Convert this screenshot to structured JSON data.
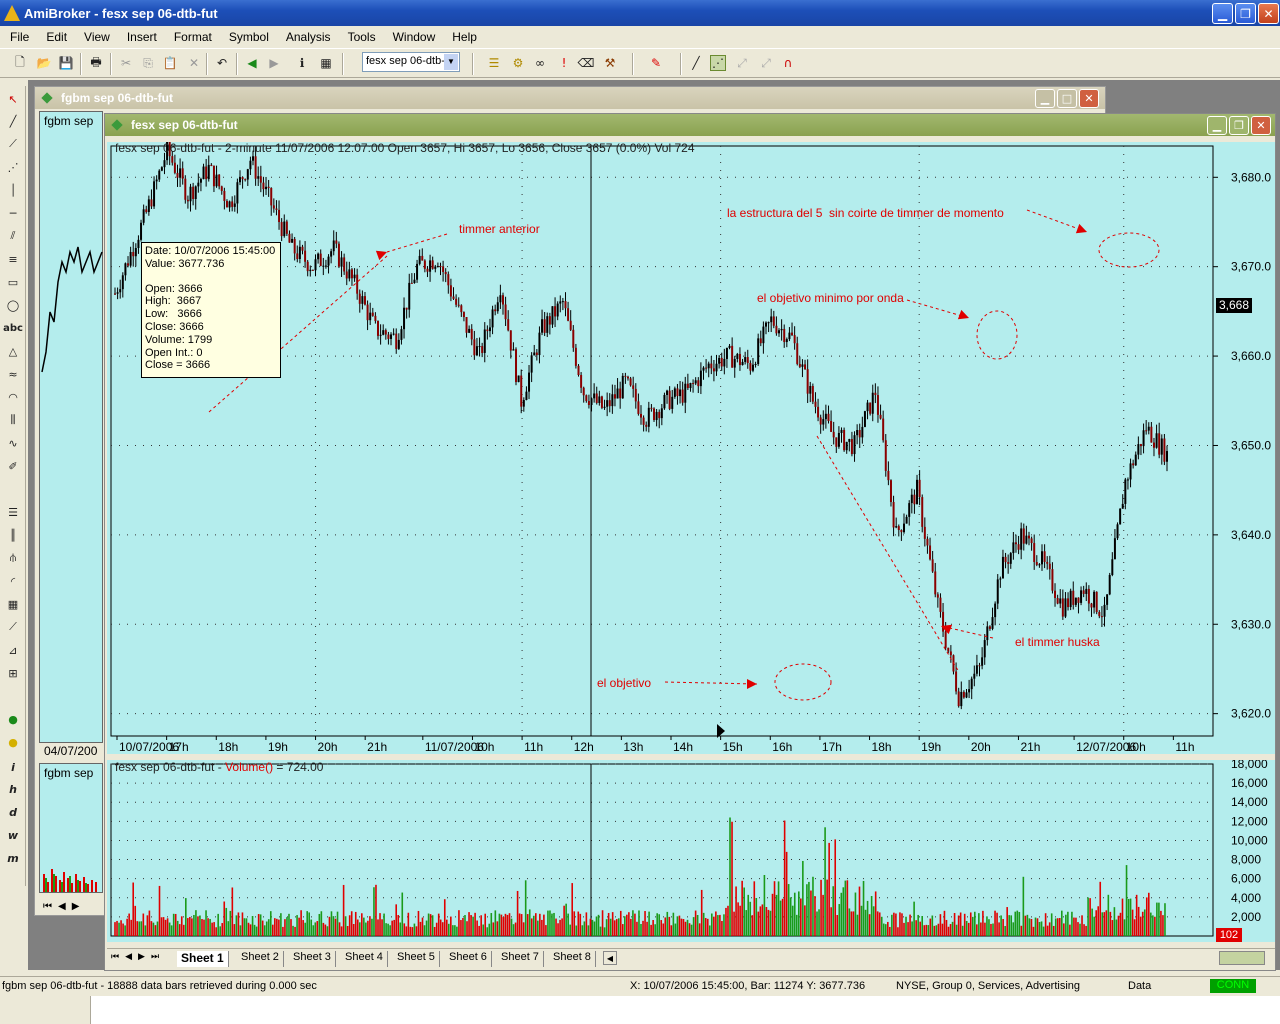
{
  "app": {
    "title": "AmiBroker - fesx sep 06-dtb-fut",
    "min_glyph": "▁",
    "max_glyph": "❐",
    "close_glyph": "✕"
  },
  "menu": [
    "File",
    "Edit",
    "View",
    "Insert",
    "Format",
    "Symbol",
    "Analysis",
    "Tools",
    "Window",
    "Help"
  ],
  "toolbar": {
    "symbol_value": "fesx sep 06-dtb-",
    "icons": [
      "new-icon",
      "open-icon",
      "save-icon",
      "print-icon",
      "cut-icon",
      "copy-icon",
      "paste-icon",
      "delete-icon",
      "undo-icon",
      "back-icon",
      "forward-icon",
      "info-icon",
      "calendar-icon",
      "database-icon",
      "gear-icon",
      "binoculars-icon",
      "alert-icon",
      "eraser-icon",
      "hammer-icon",
      "color-pen-icon",
      "line-icon",
      "dashed-line-icon",
      "magnet-icon"
    ]
  },
  "left_tools": [
    "select",
    "line",
    "ray",
    "extended-line",
    "vertical-line",
    "horizontal-line",
    "parallel-lines",
    "fibonacci",
    "rectangle",
    "ellipse",
    "text",
    "triangle",
    "arc",
    "curve",
    "cycle",
    "zigzag",
    "pen",
    "list",
    "bars",
    "pitchfork",
    "arc-fan",
    "grid",
    "fan",
    "ruler",
    "pattern",
    "green-button",
    "yellow-button",
    "italic-i",
    "italic-h",
    "italic-d",
    "italic-w",
    "italic-m"
  ],
  "left_tools_text": {
    "abc": "abc",
    "i": "i",
    "h": "h",
    "d": "d",
    "w": "w",
    "m": "m"
  },
  "windows": {
    "back_title": "fgbm sep 06-dtb-fut",
    "back_pane_label": "fgbm sep",
    "back_date_label": "04/07/200",
    "back_vol_label": "fgbm sep",
    "front_title": "fesx sep 06-dtb-fut"
  },
  "chart_header": "fesx sep 06-dtb-fut - 2-minute 11/07/2006 12:07:00 Open 3657, Hi 3657, Lo 3656, Close 3657 (0.0%) Vol 724",
  "volume_header": {
    "prefix": "fesx sep 06-dtb-fut - ",
    "func": "Volume()",
    "value": " = 724.00"
  },
  "tooltip": {
    "date": "Date: 10/07/2006 15:45:00",
    "value": "Value: 3677.736",
    "open": "Open: 3666",
    "high": "High:  3667",
    "low": "Low:   3666",
    "close": "Close: 3666",
    "volume": "Volume: 1799",
    "open_int": "Open Int.: 0",
    "close_eq": "Close = 3666"
  },
  "price_badge": "3,668",
  "vol_badge": "102",
  "annotations": {
    "timmer_anterior": "timmer anterior",
    "estructura": "la estructura del 5  sin coirte de timmer de momento",
    "objetivo_minimo": "el objetivo minimo por onda",
    "timmer_huska": "el timmer huska",
    "objetivo": "el objetivo"
  },
  "chart_data": [
    {
      "type": "candlestick",
      "title": "fesx sep 06-dtb-fut - 2-minute",
      "y_ticks": [
        "3,680.0",
        "3,670.0",
        "3,660.0",
        "3,650.0",
        "3,640.0",
        "3,630.0",
        "3,620.0"
      ],
      "y_tick_values": [
        3680,
        3670,
        3660,
        3650,
        3640,
        3630,
        3620
      ],
      "ylim": [
        3617.5,
        3683.5
      ],
      "x_ticks": [
        "10/07/2006",
        "17h",
        "18h",
        "19h",
        "20h",
        "21h",
        "11/07/2006",
        "10h",
        "11h",
        "12h",
        "13h",
        "14h",
        "15h",
        "16h",
        "17h",
        "18h",
        "19h",
        "20h",
        "21h",
        "12/07/2006",
        "10h",
        "11h"
      ],
      "series": [
        {
          "name": "close",
          "x_index": [
            0,
            12,
            20,
            28,
            36,
            44,
            52,
            60,
            68,
            76,
            84,
            92,
            100,
            108,
            116,
            124,
            132,
            140,
            148,
            156,
            164,
            172,
            180,
            188,
            196,
            204,
            212,
            220,
            228,
            236,
            244,
            252,
            260,
            268,
            276,
            284,
            292,
            300,
            308,
            316,
            324,
            332,
            340,
            348,
            356,
            364,
            372,
            380,
            388,
            396,
            404
          ],
          "values": [
            3667,
            3676,
            3683,
            3678,
            3681,
            3677,
            3682,
            3677,
            3672,
            3670,
            3672,
            3668,
            3663,
            3662,
            3670,
            3671,
            3665,
            3660,
            3668,
            3655,
            3663,
            3666,
            3656,
            3654,
            3657,
            3653,
            3655,
            3656,
            3659,
            3660,
            3659,
            3664,
            3662,
            3655,
            3651,
            3650,
            3656,
            3640,
            3645,
            3632,
            3622,
            3625,
            3636,
            3640,
            3637,
            3632,
            3634,
            3631,
            3646,
            3652,
            3649
          ]
        }
      ]
    },
    {
      "type": "bar",
      "title": "Volume()",
      "y_ticks": [
        "18,000",
        "16,000",
        "14,000",
        "12,000",
        "10,000",
        "8,000",
        "6,000",
        "4,000",
        "2,000"
      ],
      "y_tick_values": [
        18000,
        16000,
        14000,
        12000,
        10000,
        8000,
        6000,
        4000,
        2000
      ],
      "ylim": [
        0,
        18000
      ],
      "last_value": 724
    }
  ],
  "sheets": [
    "Sheet 1",
    "Sheet 2",
    "Sheet 3",
    "Sheet 4",
    "Sheet 5",
    "Sheet 6",
    "Sheet 7",
    "Sheet 8"
  ],
  "status": {
    "left": "fgbm sep 06-dtb-fut - 18888 data bars retrieved during 0.000 sec",
    "xy": "X: 10/07/2006 15:45:00, Bar: 11274 Y: 3677.736",
    "exchange": "NYSE, Group 0, Services, Advertising",
    "data": "Data",
    "conn": "CONN"
  },
  "colors": {
    "chart_bg": "#b4eded",
    "accent": "#e00000",
    "up_volume": "#1a9a1a",
    "down_volume": "#e00000"
  }
}
